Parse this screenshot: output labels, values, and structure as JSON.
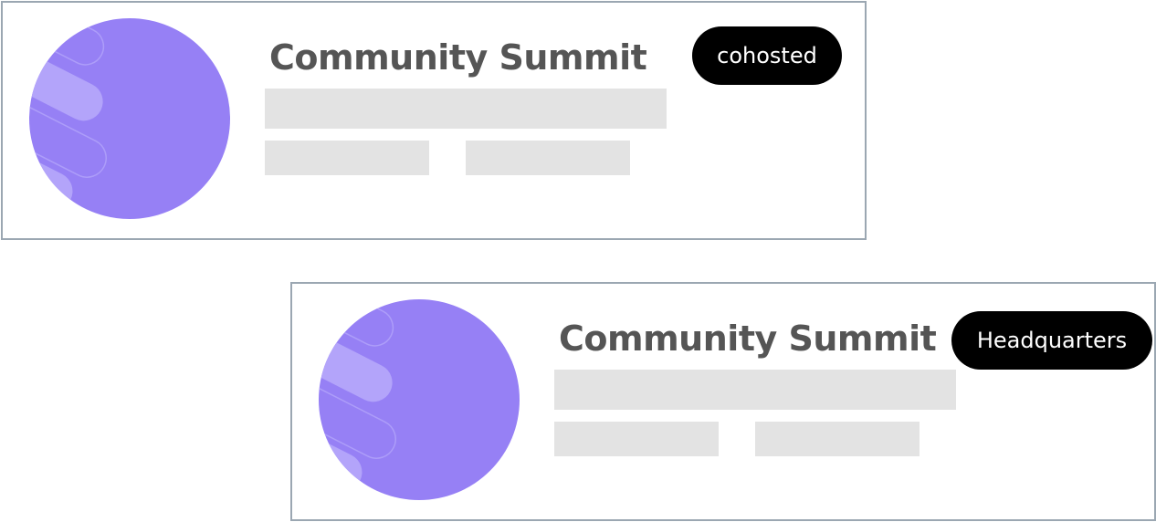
{
  "colors": {
    "avatar_fill": "#9680f5",
    "avatar_stripe": "#b3a4fa",
    "card_border": "#9ba7b2",
    "skeleton": "#e3e3e3",
    "title_text": "#555555",
    "badge_bg": "#000000",
    "badge_text": "#ffffff"
  },
  "cards": [
    {
      "title": "Community Summit",
      "badge": "cohosted",
      "avatar_icon": "event-avatar-icon"
    },
    {
      "title": "Community Summit",
      "badge": "Headquarters",
      "avatar_icon": "event-avatar-icon"
    }
  ]
}
